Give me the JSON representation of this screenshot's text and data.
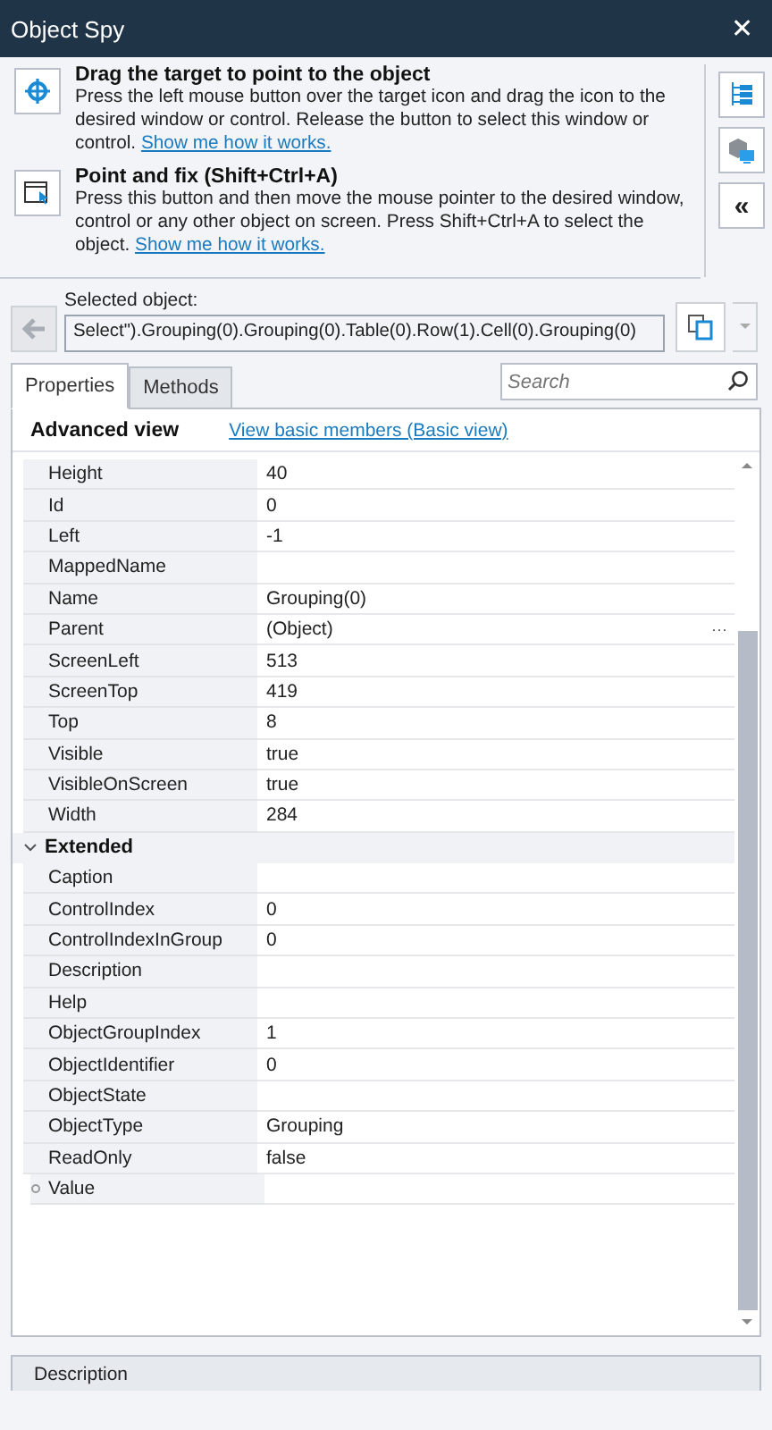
{
  "window": {
    "title": "Object Spy",
    "close": "✕"
  },
  "instructions": [
    {
      "kind": "target",
      "title": "Drag the target to point to the object",
      "text": "Press the left mouse button over the target icon and drag the icon to the desired window or control. Release the button to select this window or control.",
      "link": "Show me how it works."
    },
    {
      "kind": "pointer",
      "title": "Point and fix (Shift+Ctrl+A)",
      "text": "Press this button and then move the mouse pointer to the desired window, control or any other object on screen. Press Shift+Ctrl+A to select the object.",
      "link": "Show me how it works."
    }
  ],
  "side_buttons": [
    {
      "kind": "tree"
    },
    {
      "kind": "object"
    },
    {
      "kind": "collapse",
      "label": "«"
    }
  ],
  "selected_object": {
    "label": "Selected object:",
    "value": "Select\").Grouping(0).Grouping(0).Table(0).Row(1).Cell(0).Grouping(0)"
  },
  "tabs": [
    {
      "label": "Properties",
      "selected": true
    },
    {
      "label": "Methods",
      "selected": false
    }
  ],
  "search": {
    "placeholder": "Search"
  },
  "view": {
    "title": "Advanced view",
    "link": "View basic members (Basic view)"
  },
  "properties": [
    {
      "name": "Height",
      "value": "40"
    },
    {
      "name": "Id",
      "value": "0"
    },
    {
      "name": "Left",
      "value": "-1"
    },
    {
      "name": "MappedName"
    },
    {
      "name": "Name",
      "value": "Grouping(0)"
    },
    {
      "name": "Parent",
      "value": "(Object)",
      "ellipsis": "···"
    },
    {
      "name": "ScreenLeft",
      "value": "513"
    },
    {
      "name": "ScreenTop",
      "value": "419"
    },
    {
      "name": "Top",
      "value": "8"
    },
    {
      "name": "Visible",
      "value": "true"
    },
    {
      "name": "VisibleOnScreen",
      "value": "true"
    },
    {
      "name": "Width",
      "value": "284"
    }
  ],
  "extended": {
    "label": "Extended",
    "expanded": true,
    "rows": [
      {
        "name": "Caption",
        "nested": false
      },
      {
        "name": "ControlIndex",
        "value": "0",
        "nested": false
      },
      {
        "name": "ControlIndexInGroup",
        "value": "0",
        "nested": false
      },
      {
        "name": "Description",
        "nested": false
      },
      {
        "name": "Help",
        "nested": false
      },
      {
        "name": "ObjectGroupIndex",
        "value": "1",
        "nested": false
      },
      {
        "name": "ObjectIdentifier",
        "value": "0",
        "nested": false
      },
      {
        "name": "ObjectState",
        "nested": false
      },
      {
        "name": "ObjectType",
        "value": "Grouping",
        "nested": false
      },
      {
        "name": "ReadOnly",
        "value": "false",
        "nested": false
      },
      {
        "name": "Value",
        "nested": true
      }
    ]
  },
  "description": {
    "label": "Description"
  }
}
